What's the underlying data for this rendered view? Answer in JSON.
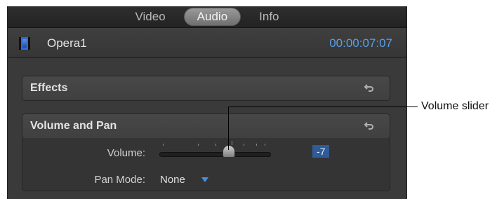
{
  "tabs": {
    "video": "Video",
    "audio": "Audio",
    "info": "Info"
  },
  "clip": {
    "icon": "film-clip-icon",
    "name": "Opera1",
    "timecode": "00:00:07:07"
  },
  "effects": {
    "title": "Effects",
    "reset_icon": "reset-arrow-icon"
  },
  "volume_and_pan": {
    "title": "Volume and Pan",
    "reset_icon": "reset-arrow-icon",
    "volume_label": "Volume:",
    "volume_value": "-7",
    "pan_mode_label": "Pan Mode:",
    "pan_mode_value": "None"
  },
  "annotation": {
    "label": "Volume slider"
  },
  "colors": {
    "timecode": "#5aa0e8",
    "value_highlight": "#2f5c98",
    "dropdown_arrow": "#4a8fe0"
  }
}
